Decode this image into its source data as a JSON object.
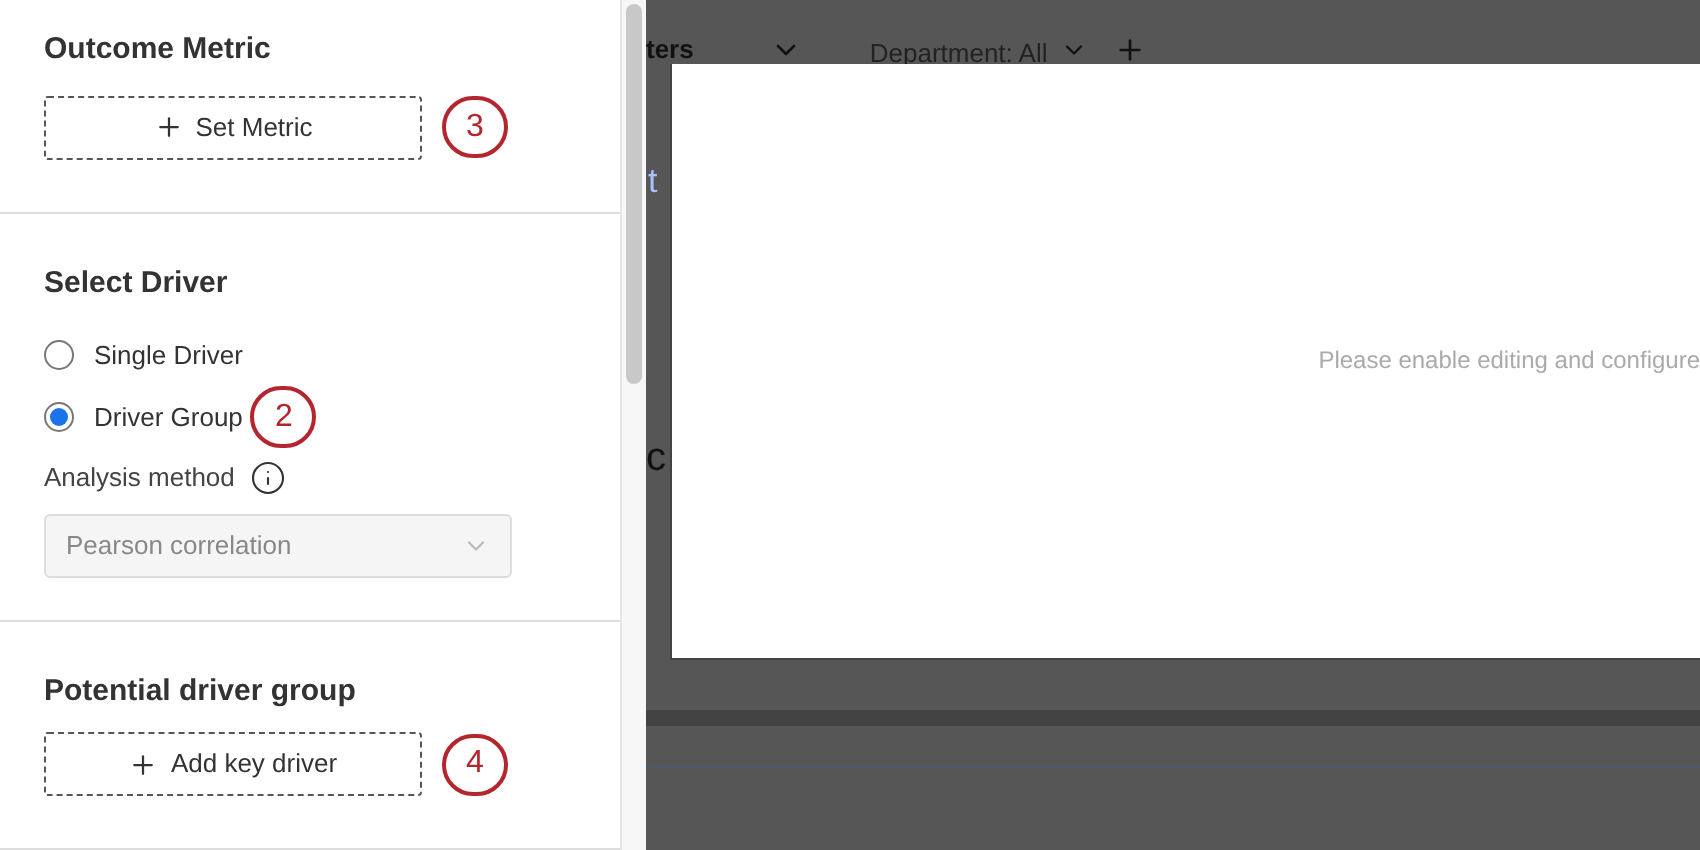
{
  "panel": {
    "outcome_metric": {
      "title": "Outcome Metric",
      "button": "Set Metric",
      "callout": "3"
    },
    "select_driver": {
      "title": "Select Driver",
      "options": [
        {
          "label": "Single Driver",
          "selected": false
        },
        {
          "label": "Driver Group",
          "selected": true,
          "callout": "2"
        }
      ],
      "analysis_method": {
        "label": "Analysis method",
        "value": "Pearson correlation"
      }
    },
    "potential_driver_group": {
      "title": "Potential driver group",
      "button": "Add key driver",
      "callout": "4"
    }
  },
  "background": {
    "filter_label": "ters",
    "department_filter": "Department: All",
    "link_fragment": "t",
    "heading_fragment": "c"
  },
  "modal": {
    "message": "Please enable editing and configure"
  }
}
